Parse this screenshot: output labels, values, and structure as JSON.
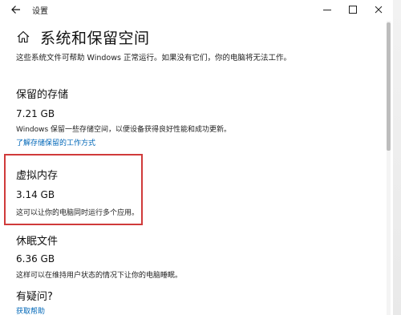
{
  "window": {
    "title": "设置",
    "back_icon": "arrow-left-icon",
    "controls": [
      "minimize-icon",
      "maximize-icon",
      "close-icon"
    ]
  },
  "page": {
    "title": "系统和保留空间",
    "home_icon": "home-icon",
    "description": "这些系统文件可帮助 Windows 正常运行。如果没有它们，你的电脑将无法工作。"
  },
  "sections": {
    "reserved": {
      "title": "保留的存储",
      "size": "7.21 GB",
      "desc": "Windows 保留一些存储空间，以便设备获得良好性能和成功更新。",
      "link": "了解存储保留的工作方式"
    },
    "virtual_memory": {
      "title": "虚拟内存",
      "size": "3.14 GB",
      "desc": "这可以让你的电脑同时运行多个应用。"
    },
    "hibernation": {
      "title": "休眠文件",
      "size": "6.36 GB",
      "desc": "这样可以在维持用户状态的情况下让你的电脑睡眠。"
    },
    "questions": {
      "title": "有疑问?",
      "link": "获取帮助"
    }
  },
  "colors": {
    "link": "#0067b8",
    "highlight": "#d03a3a"
  }
}
